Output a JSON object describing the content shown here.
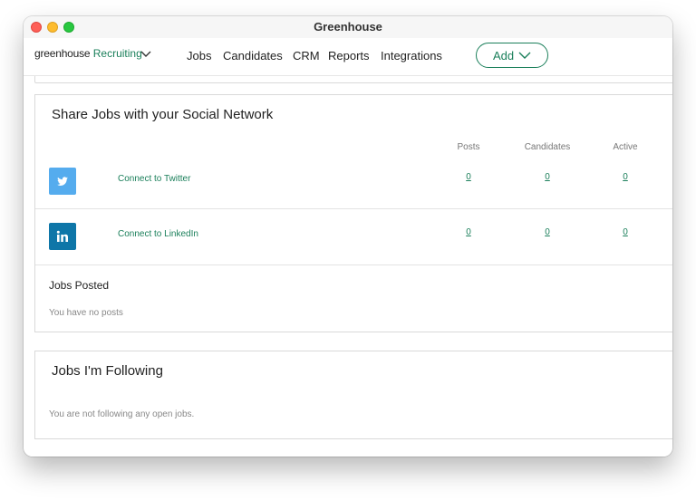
{
  "window": {
    "title": "Greenhouse"
  },
  "brand": {
    "name": "greenhouse",
    "product": "Recruiting"
  },
  "nav": {
    "items": [
      {
        "label": "Jobs"
      },
      {
        "label": "Candidates"
      },
      {
        "label": "CRM"
      },
      {
        "label": "Reports"
      },
      {
        "label": "Integrations"
      }
    ],
    "add_label": "Add"
  },
  "social": {
    "title": "Share Jobs with your Social Network",
    "columns": [
      "Posts",
      "Candidates",
      "Active"
    ],
    "rows": [
      {
        "icon": "twitter-icon",
        "label": "Connect to Twitter",
        "posts": "0",
        "candidates": "0",
        "active": "0"
      },
      {
        "icon": "linkedin-icon",
        "label": "Connect to LinkedIn",
        "posts": "0",
        "candidates": "0",
        "active": "0"
      }
    ],
    "posted_heading": "Jobs Posted",
    "posted_empty": "You have no posts"
  },
  "following": {
    "title": "Jobs I'm Following",
    "empty": "You are not following any open jobs."
  },
  "colors": {
    "brand_green": "#1a7f5a",
    "twitter_blue": "#55acee",
    "linkedin_blue": "#0e76a8"
  }
}
